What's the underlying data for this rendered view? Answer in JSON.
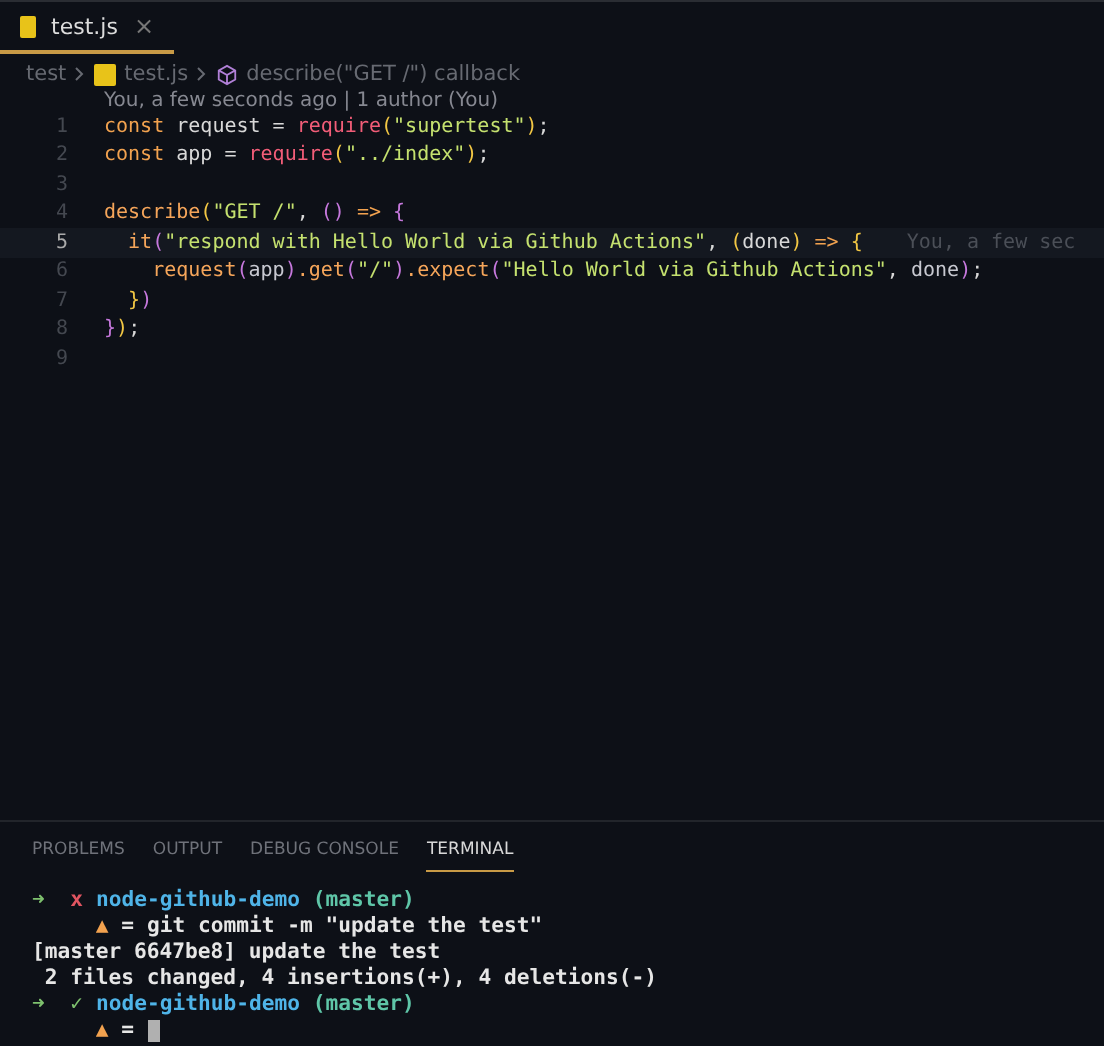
{
  "tabs": [
    {
      "label": "test.js",
      "selected": true,
      "close": "×"
    }
  ],
  "breadcrumb": [
    {
      "label": "test",
      "kind": "folder"
    },
    {
      "label": "test.js",
      "kind": "file"
    },
    {
      "label": "describe(\"GET /\") callback",
      "kind": "symbol"
    }
  ],
  "blame": "You, a few seconds ago | 1 author (You)",
  "code": [
    {
      "number": "1",
      "current": false,
      "tokens": [
        {
          "t": "const",
          "kind": "kw"
        },
        {
          "t": " request = ",
          "kind": "plain"
        },
        {
          "t": "require",
          "kind": "fn"
        },
        {
          "t": "(",
          "kind": "p1"
        },
        {
          "t": "\"supertest\"",
          "kind": "str"
        },
        {
          "t": ")",
          "kind": "p1"
        },
        {
          "t": ";",
          "kind": "plain"
        }
      ]
    },
    {
      "number": "2",
      "current": false,
      "tokens": [
        {
          "t": "const",
          "kind": "kw"
        },
        {
          "t": " app = ",
          "kind": "plain"
        },
        {
          "t": "require",
          "kind": "fn"
        },
        {
          "t": "(",
          "kind": "p1"
        },
        {
          "t": "\"../index\"",
          "kind": "str"
        },
        {
          "t": ")",
          "kind": "p1"
        },
        {
          "t": ";",
          "kind": "plain"
        }
      ]
    },
    {
      "number": "3",
      "current": false
    },
    {
      "number": "4",
      "current": false,
      "tokens": [
        {
          "t": "describe",
          "kind": "call"
        },
        {
          "t": "(",
          "kind": "p1"
        },
        {
          "t": "\"GET /\"",
          "kind": "str"
        },
        {
          "t": ", ",
          "kind": "plain"
        },
        {
          "t": "()",
          "kind": "p2"
        },
        {
          "t": " => ",
          "kind": "kw"
        },
        {
          "t": "{",
          "kind": "p2"
        }
      ]
    },
    {
      "number": "5",
      "current": true,
      "tokens": [
        {
          "t": "  it",
          "kind": "call"
        },
        {
          "t": "(",
          "kind": "p2"
        },
        {
          "t": "\"respond with Hello World via Github Actions\"",
          "kind": "str"
        },
        {
          "t": ", ",
          "kind": "plain"
        },
        {
          "t": "(",
          "kind": "p1"
        },
        {
          "t": "done",
          "kind": "plain"
        },
        {
          "t": ")",
          "kind": "p1"
        },
        {
          "t": " => ",
          "kind": "kw"
        },
        {
          "t": "{",
          "kind": "p1"
        }
      ],
      "annotation": "You, a few sec"
    },
    {
      "number": "6",
      "current": false,
      "tokens": [
        {
          "t": "    request",
          "kind": "call"
        },
        {
          "t": "(",
          "kind": "p2"
        },
        {
          "t": "app",
          "kind": "var"
        },
        {
          "t": ")",
          "kind": "p2"
        },
        {
          "t": ".get",
          "kind": "call"
        },
        {
          "t": "(",
          "kind": "p2"
        },
        {
          "t": "\"/\"",
          "kind": "str"
        },
        {
          "t": ")",
          "kind": "p2"
        },
        {
          "t": ".expect",
          "kind": "call"
        },
        {
          "t": "(",
          "kind": "p2"
        },
        {
          "t": "\"Hello World via Github Actions\"",
          "kind": "str"
        },
        {
          "t": ", ",
          "kind": "plain"
        },
        {
          "t": "done",
          "kind": "var"
        },
        {
          "t": ")",
          "kind": "p2"
        },
        {
          "t": ";",
          "kind": "plain"
        }
      ]
    },
    {
      "number": "7",
      "current": false,
      "tokens": [
        {
          "t": "  }",
          "kind": "p1"
        },
        {
          "t": ")",
          "kind": "p2"
        }
      ]
    },
    {
      "number": "8",
      "current": false,
      "tokens": [
        {
          "t": "}",
          "kind": "p2"
        },
        {
          "t": ")",
          "kind": "p1"
        },
        {
          "t": ";",
          "kind": "plain"
        }
      ]
    },
    {
      "number": "9",
      "current": false
    }
  ],
  "panel_tabs": [
    {
      "label": "PROBLEMS",
      "selected": false
    },
    {
      "label": "OUTPUT",
      "selected": false
    },
    {
      "label": "DEBUG CONSOLE",
      "selected": false
    },
    {
      "label": "TERMINAL",
      "selected": true
    }
  ],
  "terminal": [
    {
      "kind": "prompt",
      "arrow": "➜",
      "status": "x",
      "ok": false,
      "dir": "node-github-demo",
      "branch": "(master)"
    },
    {
      "kind": "command",
      "mark": "▲",
      "eq": "=",
      "text": "git commit -m \"update the test\""
    },
    {
      "kind": "output",
      "text": "[master 6647be8] update the test"
    },
    {
      "kind": "output",
      "text": " 2 files changed, 4 insertions(+), 4 deletions(-)"
    },
    {
      "kind": "prompt",
      "arrow": "➜",
      "status": "✓",
      "ok": true,
      "dir": "node-github-demo",
      "branch": "(master)"
    },
    {
      "kind": "command",
      "mark": "▲",
      "eq": "=",
      "cursor": true
    }
  ]
}
